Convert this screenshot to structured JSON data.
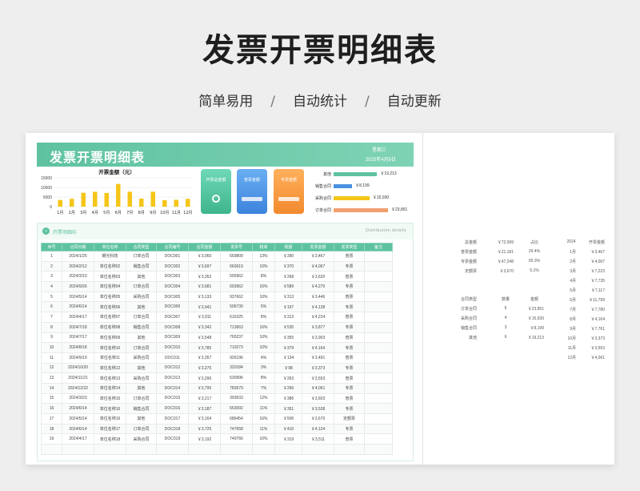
{
  "hero": {
    "title": "发票开票明细表",
    "taglines": [
      "简单易用",
      "自动统计",
      "自动更新"
    ],
    "separator": "/"
  },
  "sheet": {
    "title": "发票开票明细表",
    "weekday": "星期三",
    "date": "2025年4月9日"
  },
  "monthly_chart": {
    "title": "开票金额（元）"
  },
  "chart_data": {
    "type": "bar",
    "title": "开票金额（元）",
    "categories": [
      "1月",
      "2月",
      "3月",
      "4月",
      "5月",
      "6月",
      "7月",
      "8月",
      "9月",
      "10月",
      "11月",
      "12月"
    ],
    "values": [
      3467,
      4067,
      7223,
      7735,
      7117,
      11799,
      7780,
      4164,
      7761,
      3373,
      3553,
      4061
    ],
    "yticks": [
      "15000",
      "10000",
      "5000",
      "0"
    ],
    "ylim": [
      0,
      15000
    ],
    "colors": {
      "bar": "#f5c518"
    }
  },
  "tiles": [
    {
      "label": "开票总金额",
      "icon": "ring-icon",
      "color": "#4cbf96"
    },
    {
      "label": "普票金额",
      "icon": "bar-icon",
      "color": "#4a91e2"
    },
    {
      "label": "专票金额",
      "icon": "bar-icon",
      "color": "#f5993a"
    }
  ],
  "contract_bars": [
    {
      "label": "其他",
      "value": "￥19,213",
      "fraction": 0.8,
      "color": "#5ec2a0"
    },
    {
      "label": "销售合同",
      "value": "￥8,199",
      "fraction": 0.34,
      "color": "#4a91e2"
    },
    {
      "label": "采购合同",
      "value": "￥15,930",
      "fraction": 0.66,
      "color": "#f5c518"
    },
    {
      "label": "订单合同",
      "value": "￥23,851",
      "fraction": 1.0,
      "color": "#f0a070"
    }
  ],
  "detail": {
    "title": "开票明细栏",
    "en_title": "Distribution details",
    "columns": [
      "序号",
      "合同日期",
      "单位名称",
      "合同类型",
      "合同编号",
      "合同金额",
      "发票号",
      "税率",
      "税额",
      "发票金额",
      "发票类型",
      "备注"
    ],
    "rows": [
      [
        "1",
        "2024/1/25",
        "朝光科技",
        "订单合同",
        "DOC001",
        "￥3,060",
        "659809",
        "13%",
        "￥390",
        "￥3,467",
        "普票",
        ""
      ],
      [
        "2",
        "2024/2/12",
        "单位名称02",
        "销售合同",
        "DOC002",
        "￥3,697",
        "660619",
        "10%",
        "￥370",
        "￥4,067",
        "专票",
        ""
      ],
      [
        "3",
        "2024/3/10",
        "单位名称03",
        "其他",
        "DOC003",
        "￥3,352",
        "595962",
        "8%",
        "￥268",
        "￥3,620",
        "普票",
        ""
      ],
      [
        "4",
        "2024/9/26",
        "单位名称04",
        "订单合同",
        "DOC004",
        "￥3,681",
        "693962",
        "16%",
        "￥589",
        "￥4,270",
        "专票",
        ""
      ],
      [
        "5",
        "2024/5/14",
        "单位名称05",
        "采购合同",
        "DOC005",
        "￥3,133",
        "937662",
        "10%",
        "￥313",
        "￥3,446",
        "普票",
        ""
      ],
      [
        "6",
        "2024/6/14",
        "单位名称06",
        "其他",
        "DOC006",
        "￥3,941",
        "506730",
        "5%",
        "￥197",
        "￥4,138",
        "专票",
        ""
      ],
      [
        "7",
        "2024/4/17",
        "单位名称07",
        "订单合同",
        "DOC007",
        "￥3,911",
        "616325",
        "8%",
        "￥313",
        "￥4,224",
        "普票",
        ""
      ],
      [
        "8",
        "2024/7/18",
        "单位名称08",
        "销售合同",
        "DOC008",
        "￥3,342",
        "713663",
        "16%",
        "￥535",
        "￥3,877",
        "专票",
        ""
      ],
      [
        "9",
        "2024/7/17",
        "单位名称09",
        "其他",
        "DOC009",
        "￥3,548",
        "765237",
        "10%",
        "￥355",
        "￥3,903",
        "普票",
        ""
      ],
      [
        "10",
        "2024/8/18",
        "单位名称10",
        "订单合同",
        "DOC010",
        "￥3,785",
        "710273",
        "10%",
        "￥379",
        "￥4,164",
        "专票",
        ""
      ],
      [
        "11",
        "2024/9/19",
        "单位名称11",
        "采购合同",
        "DOC011",
        "￥3,357",
        "926196",
        "4%",
        "￥134",
        "￥3,491",
        "普票",
        ""
      ],
      [
        "12",
        "2024/10/20",
        "单位名称12",
        "其他",
        "DOC012",
        "￥3,275",
        "320184",
        "3%",
        "￥98",
        "￥3,373",
        "专票",
        ""
      ],
      [
        "13",
        "2024/11/21",
        "单位名称13",
        "采购合同",
        "DOC013",
        "￥3,290",
        "530996",
        "8%",
        "￥263",
        "￥3,553",
        "普票",
        ""
      ],
      [
        "14",
        "2024/12/22",
        "单位名称14",
        "其他",
        "DOC014",
        "￥3,795",
        "783679",
        "7%",
        "￥266",
        "￥4,061",
        "专票",
        ""
      ],
      [
        "15",
        "2024/3/23",
        "单位名称15",
        "订单合同",
        "DOC015",
        "￥3,217",
        "393633",
        "12%",
        "￥386",
        "￥3,603",
        "普票",
        ""
      ],
      [
        "16",
        "2024/6/14",
        "单位名称16",
        "销售合同",
        "DOC016",
        "￥3,187",
        "653092",
        "11%",
        "￥351",
        "￥3,538",
        "专票",
        ""
      ],
      [
        "17",
        "2024/5/14",
        "单位名称16",
        "其他",
        "DOC017",
        "￥3,164",
        "686454",
        "16%",
        "￥506",
        "￥3,670",
        "定额票",
        ""
      ],
      [
        "18",
        "2024/6/14",
        "单位名称17",
        "订单合同",
        "DOC018",
        "￥3,725",
        "747658",
        "11%",
        "￥410",
        "￥4,124",
        "专票",
        ""
      ],
      [
        "19",
        "2024/4/17",
        "单位名称18",
        "采购合同",
        "DOC019",
        "￥3,192",
        "749766",
        "10%",
        "￥319",
        "￥3,511",
        "普票",
        ""
      ],
      [
        "",
        "",
        "",
        "",
        "",
        "",
        "",
        "",
        "",
        "",
        "",
        ""
      ]
    ]
  },
  "summary": {
    "total_label": "总金额",
    "total_value": "￥72,999",
    "ratio_header": "占比",
    "year": "2024",
    "year_amount_header": "开票金额",
    "invoice_types": [
      {
        "label": "普票金额",
        "value": "￥21,181",
        "ratio": "29.4%"
      },
      {
        "label": "专票金额",
        "value": "￥47,248",
        "ratio": "65.3%"
      },
      {
        "label": "定额票",
        "value": "￥3,670",
        "ratio": "5.1%"
      }
    ],
    "contract_headers": [
      "合同类型",
      "数量",
      "金额"
    ],
    "contracts": [
      {
        "type": "订单合同",
        "count": "6",
        "amount": "￥23,851"
      },
      {
        "type": "采购合同",
        "count": "4",
        "amount": "￥15,930"
      },
      {
        "type": "销售合同",
        "count": "3",
        "amount": "￥8,199"
      },
      {
        "type": "其他",
        "count": "6",
        "amount": "￥19,213"
      }
    ],
    "months": [
      {
        "month": "1月",
        "amount": "￥3,467"
      },
      {
        "month": "2月",
        "amount": "￥4,067"
      },
      {
        "month": "3月",
        "amount": "￥7,223"
      },
      {
        "month": "4月",
        "amount": "￥7,735"
      },
      {
        "month": "5月",
        "amount": "￥7,117"
      },
      {
        "month": "6月",
        "amount": "￥11,799"
      },
      {
        "month": "7月",
        "amount": "￥7,780"
      },
      {
        "month": "8月",
        "amount": "￥4,164"
      },
      {
        "month": "9月",
        "amount": "￥7,761"
      },
      {
        "month": "10月",
        "amount": "￥3,373"
      },
      {
        "month": "11月",
        "amount": "￥3,553"
      },
      {
        "month": "12月",
        "amount": "￥4,061"
      }
    ]
  }
}
